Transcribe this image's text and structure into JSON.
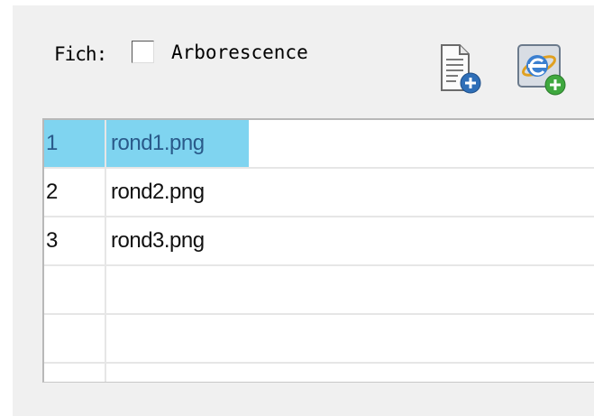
{
  "toolbar": {
    "fich_label": "Fich:",
    "arborescence_label": "Arborescence",
    "arborescence_checked": false,
    "new_file_icon": "new-file-add-icon",
    "web_add_icon": "ie-add-icon"
  },
  "grid": {
    "rows": [
      {
        "num": "1",
        "name": "rond1.png",
        "selected": true
      },
      {
        "num": "2",
        "name": "rond2.png",
        "selected": false
      },
      {
        "num": "3",
        "name": "rond3.png",
        "selected": false
      },
      {
        "num": "",
        "name": "",
        "selected": false
      },
      {
        "num": "",
        "name": "",
        "selected": false
      },
      {
        "num": "",
        "name": "",
        "selected": false
      }
    ]
  },
  "colors": {
    "selection": "#7fd4f0",
    "panel": "#f0f0f0"
  }
}
